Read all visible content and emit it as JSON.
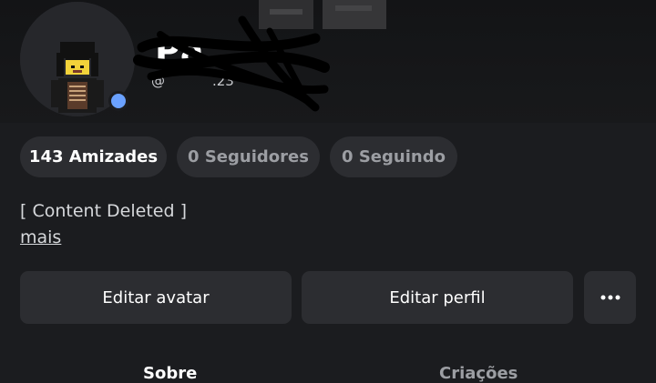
{
  "profile": {
    "display_name": "Pa",
    "username": "@",
    "username_tail": ".23",
    "presence_color": "#6aa1ff"
  },
  "stats": {
    "friends": "143 Amizades",
    "followers": "0 Seguidores",
    "following": "0 Seguindo"
  },
  "about": {
    "bio": "[ Content Deleted ]",
    "more_label": "mais"
  },
  "actions": {
    "edit_avatar": "Editar avatar",
    "edit_profile": "Editar perfil",
    "more_icon": "more-horizontal-icon"
  },
  "tabs": [
    {
      "label": "Sobre",
      "selected": true
    },
    {
      "label": "Criações",
      "selected": false
    }
  ]
}
